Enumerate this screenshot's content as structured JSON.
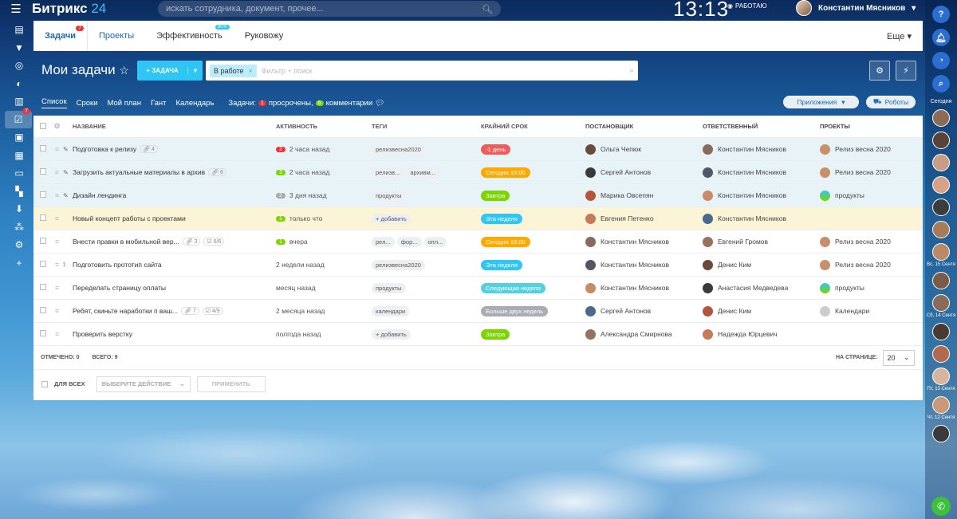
{
  "topbar": {
    "logo_text": "Битрикс",
    "logo_num": "24",
    "search_placeholder": "искать сотрудника, документ, прочее...",
    "clock": "13:13",
    "work_status": "РАБОТАЮ",
    "user_name": "Константин Мясников"
  },
  "leftbar": {
    "tasks_badge": "7"
  },
  "header": {
    "tabs": [
      {
        "label": "Задачи",
        "badge": "7"
      },
      {
        "label": "Проекты"
      },
      {
        "label": "Эффективность",
        "badge": "90%"
      },
      {
        "label": "Руковожу"
      }
    ],
    "more": "Еще"
  },
  "toolbar": {
    "title": "Мои задачи",
    "add_button": "+ ЗАДАЧА",
    "filter_tag": "В работе",
    "filter_placeholder": "Фильтр + поиск"
  },
  "views": {
    "items": [
      "Список",
      "Сроки",
      "Мой план",
      "Гант",
      "Календарь"
    ],
    "counter_label": "Задачи:",
    "overdue_count": "1",
    "overdue_label": "просрочены,",
    "comments_count": "6",
    "comments_label": "комментарии",
    "apps_button": "Приложения",
    "robots_button": "Роботы"
  },
  "table": {
    "columns": [
      "НАЗВАНИЕ",
      "АКТИВНОСТЬ",
      "ТЕГИ",
      "КРАЙНИЙ СРОК",
      "ПОСТАНОВЩИК",
      "ОТВЕТСТВЕННЫЙ",
      "ПРОЕКТЫ"
    ],
    "rows": [
      {
        "name": "Подготовка к релизу",
        "meta": "4",
        "act_badge": "2",
        "act": "2 часа назад",
        "tags": [
          "релизвесна2020"
        ],
        "deadline": "-1 день",
        "creator": "Ольга Чепюк",
        "resp": "Константин Мясников",
        "project": "Релиз весна 2020"
      },
      {
        "name": "Загрузить актуальные материалы в архив",
        "meta": "6",
        "act_badge": "3",
        "act": "2 часа назад",
        "tags": [
          "релизв...",
          "архивм..."
        ],
        "deadline": "Сегодня 19:00",
        "creator": "Сергей Антонов",
        "resp": "Константин Мясников",
        "project": "Релиз весна 2020"
      },
      {
        "name": "Дизайн лендинга",
        "meta": "",
        "act_badge": "2",
        "act": "3 дня назад",
        "tags": [
          "продукты"
        ],
        "deadline": "Завтра",
        "creator": "Марика Овсепян",
        "resp": "Константин Мясников",
        "project": "продукты"
      },
      {
        "name": "Новый концепт работы с проектами",
        "meta": "",
        "act_badge": "1",
        "act": "только что",
        "tags": [
          "+ добавить"
        ],
        "deadline": "Эта неделя",
        "creator": "Евгения Петенко",
        "resp": "Константин Мясников",
        "project": ""
      },
      {
        "name": "Внести правки в мобильной вер...",
        "meta": "3",
        "meta2": "6/6",
        "act_badge": "1",
        "act": "вчера",
        "tags": [
          "рел...",
          "фор...",
          "опл..."
        ],
        "deadline": "Сегодня 19:00",
        "creator": "Константин Мясников",
        "resp": "Евгений Громов",
        "project": "Релиз весна 2020"
      },
      {
        "name": "Подготовить прототип сайта",
        "meta": "",
        "act_badge": "",
        "act": "2 недели назад",
        "tags": [
          "релизвесна2020"
        ],
        "deadline": "Эта неделя",
        "creator": "Константин Мясников",
        "resp": "Денис Ким",
        "project": "Релиз весна 2020"
      },
      {
        "name": "Переделать страницу оплаты",
        "meta": "",
        "act_badge": "",
        "act": "месяц назад",
        "tags": [
          "продукты"
        ],
        "deadline": "Следующая неделя",
        "creator": "Константин Мясников",
        "resp": "Анастасия Медведева",
        "project": "продукты"
      },
      {
        "name": "Ребят, скиньте наработки п ваш...",
        "meta": "7",
        "meta2": "4/9",
        "act_badge": "",
        "act": "2 месяца назад",
        "tags": [
          "календари"
        ],
        "deadline": "Больше двух недель",
        "creator": "Сергей Антонов",
        "resp": "Денис Ким",
        "project": "Календари"
      },
      {
        "name": "Проверить верстку",
        "meta": "",
        "act_badge": "",
        "act": "полгода назад",
        "tags": [
          "+ добавить"
        ],
        "deadline": "Завтра",
        "creator": "Александра Смирнова",
        "resp": "Надежда Юрцевич",
        "project": ""
      }
    ],
    "footer_selected_label": "ОТМЕЧЕНО: 0",
    "footer_total_label": "ВСЕГО: 9",
    "per_page_label": "НА СТРАНИЦЕ:",
    "per_page_value": "20",
    "for_all_label": "ДЛЯ ВСЕХ",
    "choose_action": "ВЫБЕРИТЕ ДЕЙСТВИЕ",
    "apply": "ПРИМЕНИТЬ"
  },
  "rightbar": {
    "today_label": "Сегодня",
    "dates": [
      "Вс, 15 Сентя",
      "Сб, 14 Сентя",
      "Пт, 13 Сентя",
      "Чт, 12 Сентя"
    ]
  },
  "colors": {
    "accent": "#2fc6f6",
    "overdue": "#f05b5b",
    "today": "#ffa900",
    "tomorrow": "#7bd500",
    "this_week": "#2fc6f6",
    "next_week": "#55d0e0",
    "later": "#a8adb4"
  }
}
